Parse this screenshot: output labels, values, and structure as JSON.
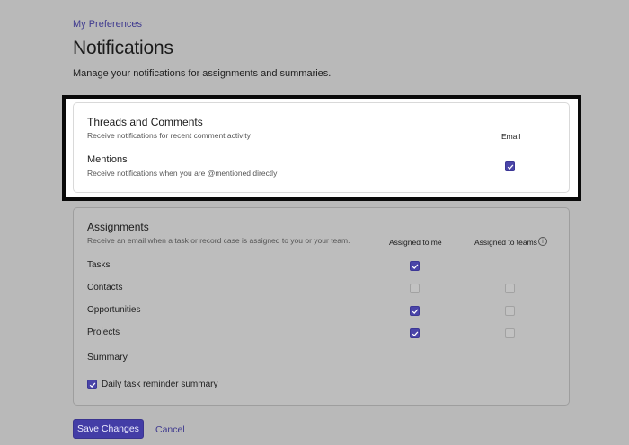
{
  "breadcrumb": "My Preferences",
  "page": {
    "title": "Notifications",
    "description": "Manage your notifications for assignments and summaries."
  },
  "threads_card": {
    "title": "Threads and Comments",
    "subtitle": "Receive notifications for recent comment activity",
    "column_email": "Email",
    "mentions": {
      "label": "Mentions",
      "description": "Receive notifications when you are @mentioned directly",
      "email_checked": true
    }
  },
  "assignments_card": {
    "title": "Assignments",
    "subtitle": "Receive an email when a task or record case is assigned to you or your team.",
    "column_me": "Assigned to me",
    "column_teams": "Assigned to teams",
    "rows": [
      {
        "label": "Tasks",
        "me": true,
        "teams": null
      },
      {
        "label": "Contacts",
        "me": false,
        "teams": false
      },
      {
        "label": "Opportunities",
        "me": true,
        "teams": false
      },
      {
        "label": "Projects",
        "me": true,
        "teams": false
      }
    ],
    "summary_title": "Summary",
    "summary_option": {
      "label": "Daily task reminder summary",
      "checked": true
    }
  },
  "actions": {
    "save_label": "Save Changes",
    "cancel_label": "Cancel"
  },
  "colors": {
    "accent": "#433da6",
    "link": "#3f3a8f",
    "overlay_bg": "#b9b9b9",
    "highlight_border": "#0a0a0a"
  }
}
